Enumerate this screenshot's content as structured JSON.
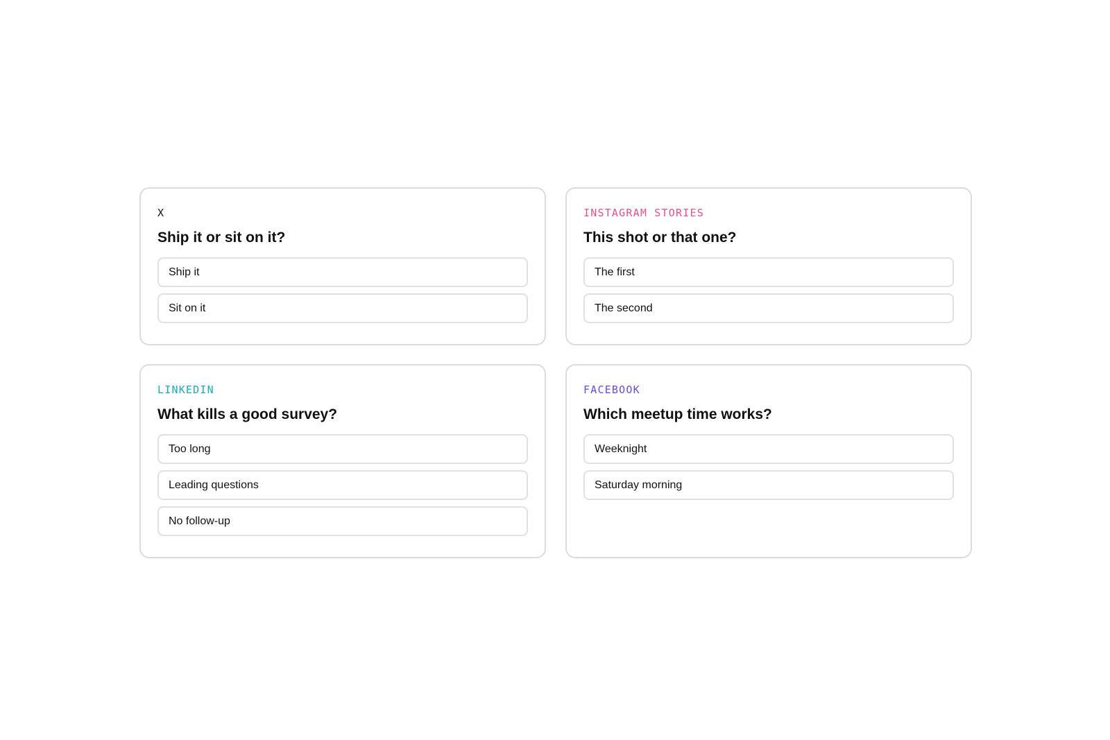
{
  "polls": [
    {
      "platform": "X",
      "platform_color": "#111111",
      "question": "Ship it or sit on it?",
      "options": [
        "Ship it",
        "Sit on it"
      ]
    },
    {
      "platform": "INSTAGRAM STORIES",
      "platform_color": "#e8508a",
      "question": "This shot or that one?",
      "options": [
        "The first",
        "The second"
      ]
    },
    {
      "platform": "LINKEDIN",
      "platform_color": "#1aaab8",
      "question": "What kills a good survey?",
      "options": [
        "Too long",
        "Leading questions",
        "No follow-up"
      ]
    },
    {
      "platform": "FACEBOOK",
      "platform_color": "#6b4bd6",
      "question": "Which meetup time works?",
      "options": [
        "Weeknight",
        "Saturday morning"
      ]
    }
  ]
}
